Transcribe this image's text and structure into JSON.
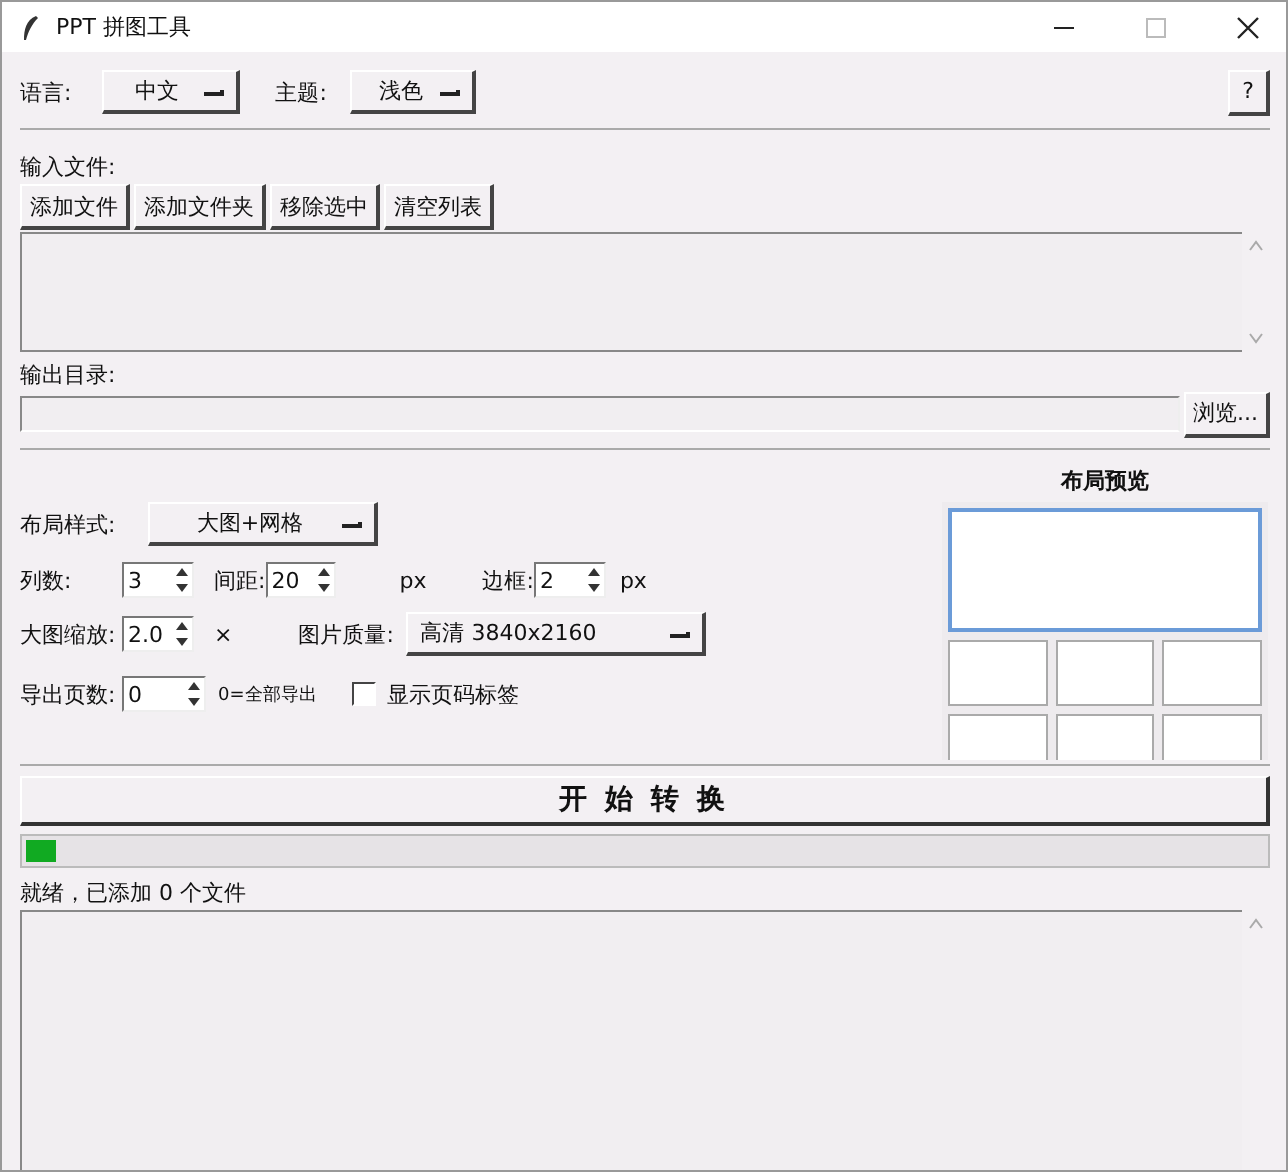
{
  "window": {
    "title": "PPT 拼图工具"
  },
  "toolbar": {
    "language": {
      "label": "语言:",
      "value": "中文"
    },
    "theme": {
      "label": "主题:",
      "value": "浅色"
    },
    "help_button": "?"
  },
  "input": {
    "label": "输入文件:",
    "buttons": [
      "添加文件",
      "添加文件夹",
      "移除选中",
      "清空列表"
    ]
  },
  "output": {
    "label": "输出目录:",
    "browse_button": "浏览..."
  },
  "settings": {
    "layout_style": {
      "label": "布局样式:",
      "value": "大图+网格"
    },
    "columns": {
      "label": "列数:",
      "value": "3"
    },
    "spacing": {
      "label": "间距:",
      "value": "20",
      "unit": "px"
    },
    "border": {
      "label": "边框:",
      "value": "2",
      "unit": "px"
    },
    "scale": {
      "label": "大图缩放:",
      "value": "2.0",
      "unit": "×"
    },
    "quality": {
      "label": "图片质量:",
      "value": "高清 3840x2160"
    },
    "pages": {
      "label": "导出页数:",
      "value": "0",
      "hint": "0=全部导出"
    },
    "show_page_labels": {
      "label": "显示页码标签",
      "checked": false
    }
  },
  "preview": {
    "title": "布局预览"
  },
  "start_button": "开 始 转 换",
  "progress": {
    "level": 0.025
  },
  "status": "就绪，已添加 0 个文件"
}
